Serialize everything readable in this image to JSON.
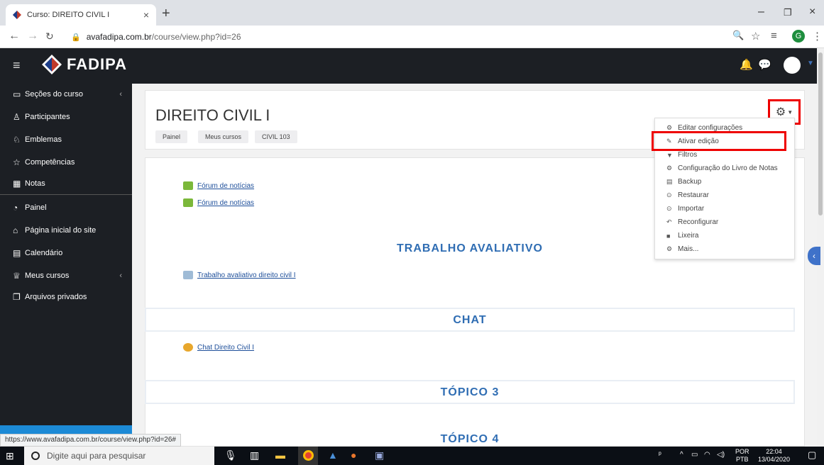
{
  "browser": {
    "tab_title": "Curso: DIREITO CIVIL I",
    "url_host": "avafadipa.com.br",
    "url_path": "/course/view.php?id=26",
    "profile_initial": "G"
  },
  "brand": {
    "name": "FADIPA",
    "accent": "#1c8ad6",
    "nav_bg": "#1c1f24"
  },
  "sidebar": {
    "items": [
      {
        "label": "Seções do curso",
        "icon": "folder-icon"
      },
      {
        "label": "Participantes",
        "icon": "users-icon"
      },
      {
        "label": "Emblemas",
        "icon": "badge-icon"
      },
      {
        "label": "Competências",
        "icon": "star-icon"
      },
      {
        "label": "Notas",
        "icon": "table-icon"
      },
      {
        "label": "Painel",
        "icon": "dashboard-icon"
      },
      {
        "label": "Página inicial do site",
        "icon": "home-icon"
      },
      {
        "label": "Calendário",
        "icon": "calendar-icon"
      },
      {
        "label": "Meus cursos",
        "icon": "graduation-icon"
      },
      {
        "label": "Arquivos privados",
        "icon": "files-icon"
      }
    ]
  },
  "header": {
    "title": "DIREITO CIVIL I",
    "breadcrumb": [
      "Painel",
      "Meus cursos",
      "CIVIL 103"
    ]
  },
  "menu": {
    "items": [
      {
        "label": "Editar configurações",
        "icon": "gear-icon"
      },
      {
        "label": "Ativar edição",
        "icon": "pencil-icon"
      },
      {
        "label": "Filtros",
        "icon": "filter-icon"
      },
      {
        "label": "Configuração do Livro de Notas",
        "icon": "gear-icon"
      },
      {
        "label": "Backup",
        "icon": "file-icon"
      },
      {
        "label": "Restaurar",
        "icon": "restore-icon"
      },
      {
        "label": "Importar",
        "icon": "import-icon"
      },
      {
        "label": "Reconfigurar",
        "icon": "reset-icon"
      },
      {
        "label": "Lixeira",
        "icon": "trash-icon"
      },
      {
        "label": "Mais...",
        "icon": "gear-icon"
      }
    ]
  },
  "content": {
    "forum1": "Fórum de notícias",
    "forum2": "Fórum de notícias",
    "section1": "TRABALHO AVALIATIVO",
    "assign1": "Trabalho avaliativo direito civil I",
    "section2": "CHAT",
    "chat1": "Chat Direito Civil I",
    "section3": "TÓPICO 3",
    "section4": "TÓPICO 4"
  },
  "status_url": "https://www.avafadipa.com.br/course/view.php?id=26#",
  "taskbar": {
    "search_placeholder": "Digite aqui para pesquisar",
    "lang": "POR",
    "lang2": "PTB",
    "time": "22:04",
    "date": "13/04/2020"
  }
}
